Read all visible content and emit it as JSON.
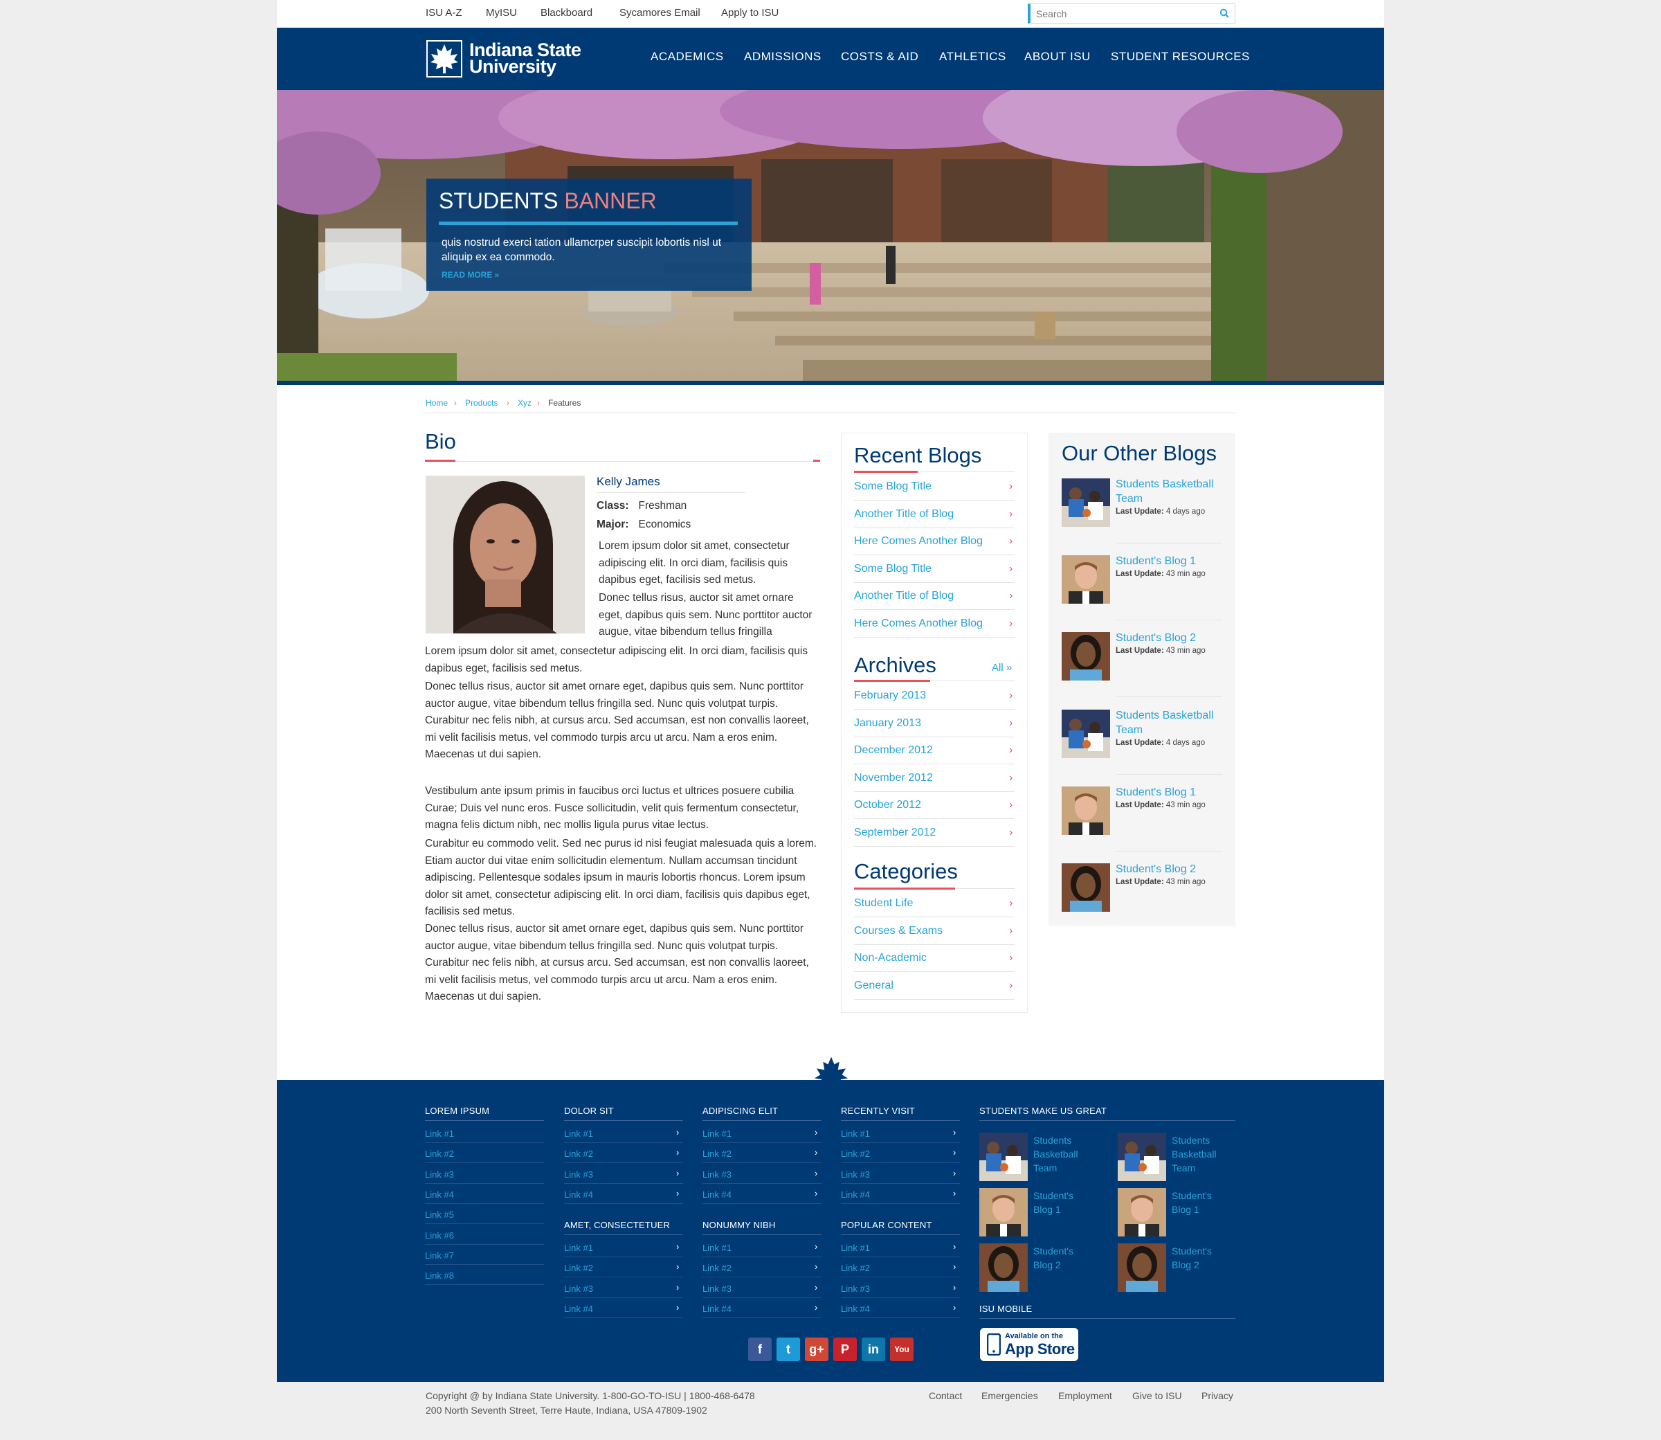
{
  "util_links": [
    "ISU A-Z",
    "MyISU",
    "Blackboard",
    "Sycamores Email",
    "Apply to ISU"
  ],
  "search": {
    "placeholder": "Search"
  },
  "logo": {
    "line1": "Indiana State",
    "line2": "University"
  },
  "nav": [
    "ACADEMICS",
    "ADMISSIONS",
    "COSTS & AID",
    "ATHLETICS",
    "ABOUT ISU",
    "STUDENT RESOURCES"
  ],
  "banner": {
    "title_main": "STUDENTS",
    "title_accent": "BANNER",
    "text": "quis nostrud exerci tation ullamcrper suscipit lobortis nisl ut aliquip ex ea commodo.",
    "read_more": "READ MORE »"
  },
  "breadcrumb": [
    "Home",
    "Products",
    "Xyz",
    "Features"
  ],
  "bio": {
    "heading": "Bio",
    "name": "Kelly James",
    "class_label": "Class:",
    "class_value": "Freshman",
    "major_label": "Major:",
    "major_value": "Economics",
    "side_p1": "Lorem ipsum dolor sit amet, consectetur adipiscing elit. In orci diam, facilisis quis dapibus eget, facilisis sed metus.",
    "side_p2": "Donec tellus risus, auctor sit amet ornare eget, dapibus quis sem. Nunc porttitor auctor augue, vitae bibendum tellus fringilla",
    "p1": "Lorem ipsum dolor sit amet, consectetur adipiscing elit. In orci diam, facilisis quis dapibus eget, facilisis sed metus.",
    "p2": "Donec tellus risus, auctor sit amet ornare eget, dapibus quis sem. Nunc porttitor auctor augue, vitae bibendum tellus fringilla sed. Nunc quis volutpat turpis. Curabitur nec felis nibh, at cursus arcu. Sed accumsan, est non convallis laoreet, mi velit facilisis metus, vel commodo turpis arcu ut arcu. Nam a eros enim. Maecenas ut dui sapien.",
    "p3": "Vestibulum ante ipsum primis in faucibus orci luctus et ultrices posuere cubilia Curae; Duis vel nunc eros. Fusce sollicitudin, velit quis fermentum consectetur, magna felis dictum nibh, nec mollis ligula purus vitae lectus.",
    "p4": "Curabitur eu commodo velit. Sed nec purus id nisi feugiat malesuada quis a lorem. Etiam auctor dui vitae enim sollicitudin elementum. Nullam accumsan tincidunt adipiscing. Pellentesque sodales ipsum in mauris lobortis rhoncus. Lorem ipsum dolor sit amet, consectetur adipiscing elit. In orci diam, facilisis quis dapibus eget, facilisis sed metus.",
    "p5": "Donec tellus risus, auctor sit amet ornare eget, dapibus quis sem. Nunc porttitor auctor augue, vitae bibendum tellus fringilla sed. Nunc quis volutpat turpis. Curabitur nec felis nibh, at cursus arcu. Sed accumsan, est non convallis laoreet, mi velit facilisis metus, vel commodo turpis arcu ut arcu. Nam a eros enim. Maecenas ut dui sapien."
  },
  "recent_blogs": {
    "title": "Recent Blogs",
    "items": [
      "Some Blog Title",
      "Another Title of Blog",
      "Here Comes Another Blog",
      "Some Blog Title",
      "Another Title of Blog",
      "Here Comes Another Blog"
    ]
  },
  "archives": {
    "title": "Archives",
    "all": "All »",
    "items": [
      "February 2013",
      "January 2013",
      "December 2012",
      "November 2012",
      "October 2012",
      "September 2012"
    ]
  },
  "categories": {
    "title": "Categories",
    "items": [
      "Student Life",
      "Courses & Exams",
      "Non-Academic",
      "General"
    ]
  },
  "other_blogs": {
    "title": "Our Other Blogs",
    "meta_label": "Last Update:",
    "items": [
      {
        "title": "Students Basketball Team",
        "update": "4 days ago",
        "thumb": "team"
      },
      {
        "title": "Student's Blog 1",
        "update": "43 min ago",
        "thumb": "man"
      },
      {
        "title": "Student's Blog 2",
        "update": "43 min ago",
        "thumb": "dread"
      },
      {
        "title": "Students Basketball Team",
        "update": "4 days ago",
        "thumb": "team"
      },
      {
        "title": "Student's Blog 1",
        "update": "43 min ago",
        "thumb": "man"
      },
      {
        "title": "Student's Blog 2",
        "update": "43 min ago",
        "thumb": "dread"
      }
    ]
  },
  "footer": {
    "col1": {
      "head": "LOREM IPSUM",
      "links": [
        "Link #1",
        "Link #2",
        "Link #3",
        "Link #4",
        "Link #5",
        "Link #6",
        "Link #7",
        "Link #8"
      ]
    },
    "col2": {
      "head": "DOLOR SIT",
      "links": [
        "Link #1",
        "Link #2",
        "Link #3",
        "Link #4"
      ],
      "head2": "AMET, CONSECTETUER",
      "links2": [
        "Link #1",
        "Link #2",
        "Link #3",
        "Link #4"
      ]
    },
    "col3": {
      "head": "ADIPISCING ELIT",
      "links": [
        "Link #1",
        "Link #2",
        "Link #3",
        "Link #4"
      ],
      "head2": "NONUMMY NIBH",
      "links2": [
        "Link #1",
        "Link #2",
        "Link #3",
        "Link #4"
      ]
    },
    "col4": {
      "head": "RECENTLY VISIT",
      "links": [
        "Link #1",
        "Link #2",
        "Link #3",
        "Link #4"
      ],
      "head2": "POPULAR CONTENT",
      "links2": [
        "Link #1",
        "Link #2",
        "Link #3",
        "Link #4"
      ]
    },
    "students": {
      "head": "STUDENTS MAKE US GREAT",
      "items": [
        "Students Basketball Team",
        "Students Basketball Team",
        "Student's Blog 1",
        "Student's Blog 1",
        "Student's Blog 2",
        "Student's Blog 2"
      ]
    },
    "mobile": {
      "head": "ISU MOBILE",
      "app_l1": "Available on the",
      "app_l2": "App Store"
    },
    "social": [
      {
        "name": "facebook",
        "glyph": "f",
        "color": "#3b5998"
      },
      {
        "name": "twitter",
        "glyph": "t",
        "color": "#1d9bd8"
      },
      {
        "name": "google-plus",
        "glyph": "g+",
        "color": "#d14836"
      },
      {
        "name": "pinterest",
        "glyph": "P",
        "color": "#c8232c"
      },
      {
        "name": "linkedin",
        "glyph": "in",
        "color": "#0e76a8"
      },
      {
        "name": "youtube",
        "glyph": "You",
        "color": "#c4302b"
      }
    ]
  },
  "bottom": {
    "copy1": "Copyright @ by Indiana State University. 1-800-GO-TO-ISU | 1800-468-6478",
    "copy2": "200 North Seventh Street, Terre Haute, Indiana, USA 47809-1902",
    "links": [
      "Contact",
      "Emergencies",
      "Employment",
      "Give to ISU",
      "Privacy"
    ]
  },
  "colors": {
    "brand": "#003a75",
    "accent": "#29a3d8",
    "red": "#e8505b"
  }
}
